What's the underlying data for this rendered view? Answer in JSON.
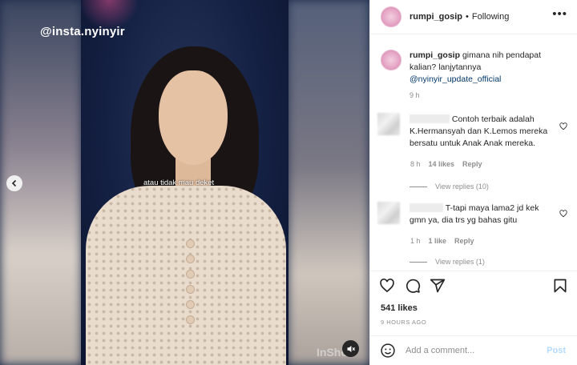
{
  "media": {
    "watermark": "@insta.nyinyir",
    "caption": "atau tidak mau deket",
    "app_watermark": "InShot",
    "icons": {
      "prev": "chevron-left-icon",
      "mute": "sound-off-icon"
    }
  },
  "header": {
    "username": "rumpi_gosip",
    "separator": "•",
    "follow_status": "Following",
    "more": "•••"
  },
  "caption_comment": {
    "username": "rumpi_gosip",
    "text": "gimana nih pendapat kalian? lanjytannya",
    "mention": "@nyinyir_update_official",
    "time": "9 h"
  },
  "comments": [
    {
      "text": "Contoh terbaik adalah K.Hermansyah dan K.Lemos mereka bersatu untuk Anak Anak mereka.",
      "time": "8 h",
      "likes": "14 likes",
      "reply": "Reply",
      "view_replies": "View replies (10)"
    },
    {
      "text": "T-tapi maya lama2 jd kek gmn ya, dia trs yg bahas gitu",
      "time": "1 h",
      "likes": "1 like",
      "reply": "Reply",
      "view_replies": "View replies (1)"
    }
  ],
  "actions": {
    "icons": [
      "heart-icon",
      "comment-icon",
      "share-icon",
      "bookmark-icon"
    ],
    "likes": "541 likes",
    "time_ago": "9 HOURS AGO"
  },
  "add_comment": {
    "placeholder": "Add a comment...",
    "post_label": "Post",
    "icon": "emoji-icon"
  },
  "colors": {
    "link": "#00376b",
    "muted": "#8e8e8e",
    "post_disabled": "#b3dbff",
    "border": "#efefef"
  }
}
